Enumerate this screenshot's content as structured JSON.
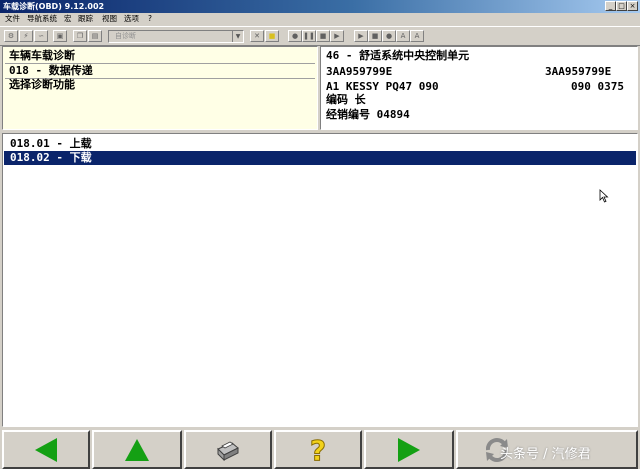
{
  "window": {
    "title": "车载诊断(OBD) 9.12.002",
    "controls": [
      "_",
      "□",
      "×"
    ]
  },
  "menu": [
    "文件",
    "导航系统",
    "宏",
    "跟踪",
    "视图",
    "选项",
    "?"
  ],
  "toolbar": {
    "combo_value": "自诊断"
  },
  "left_panel": {
    "line1": "车辆车载诊断",
    "line2": "018 - 数据传递",
    "line3": "选择诊断功能"
  },
  "right_panel": {
    "title": "46 - 舒适系统中央控制单元",
    "part_left": "3AA959799E",
    "part_right": "3AA959799E",
    "component_left": "A1 KESSY PQ47  090",
    "component_right": "090  0375",
    "code": "编码 长",
    "dealer": "经销编号 04894"
  },
  "list": [
    {
      "label": "018.01 - 上载",
      "selected": false
    },
    {
      "label": "018.02 - 下载",
      "selected": true
    }
  ],
  "bottom_buttons": [
    {
      "icon": "arrow-left-icon"
    },
    {
      "icon": "arrow-up-icon"
    },
    {
      "icon": "printer-icon"
    },
    {
      "icon": "help-icon"
    },
    {
      "icon": "arrow-right-icon"
    },
    {
      "icon": "refresh-icon"
    }
  ],
  "watermark": "头条号 / 汽修君",
  "colors": {
    "selection": "#0a246a",
    "arrow_green": "#14a014",
    "help_yellow": "#f2d21a",
    "panel_yellow": "#ffffe6"
  }
}
